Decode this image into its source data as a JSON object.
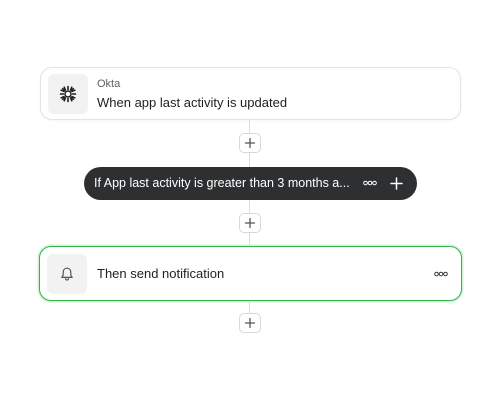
{
  "trigger": {
    "app_name": "Okta",
    "title": "When app last activity is updated",
    "icon": "okta-sunburst-icon"
  },
  "condition": {
    "text": "If App last activity is greater than 3 months a...",
    "more_icon": "more-dots-icon",
    "add_icon": "plus-icon"
  },
  "action": {
    "title": "Then send notification",
    "icon": "bell-icon",
    "more_icon": "more-dots-icon"
  },
  "colors": {
    "selected_border": "#37b24d",
    "pill_background": "#2d2f31"
  }
}
